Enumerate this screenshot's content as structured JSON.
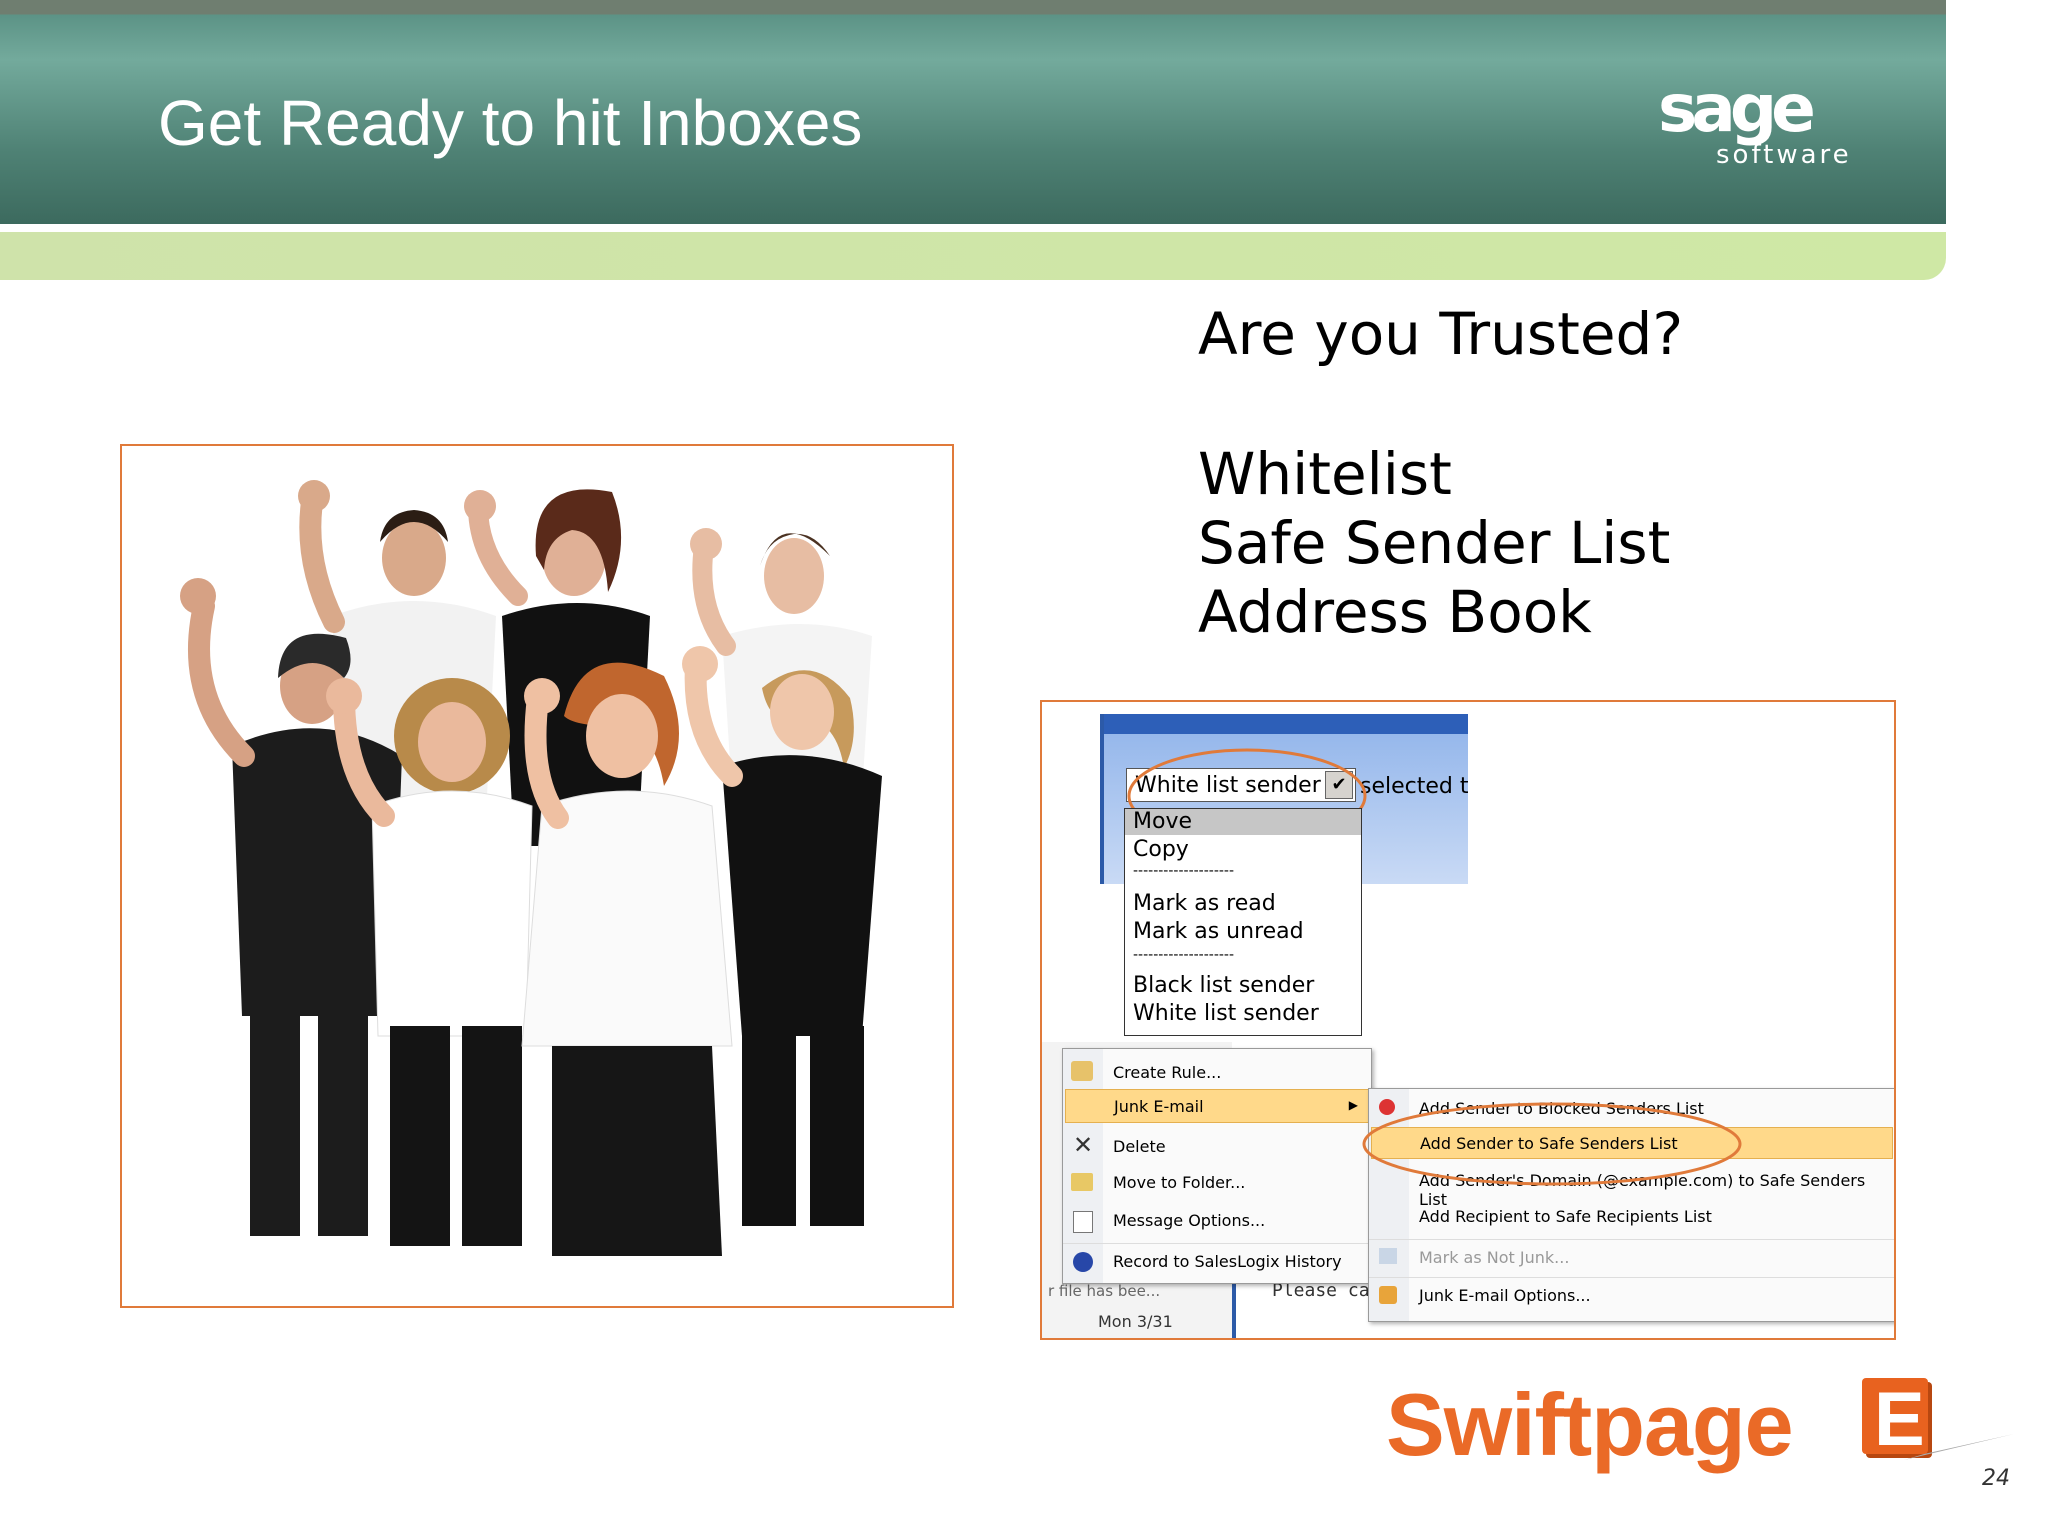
{
  "header": {
    "title": "Get Ready to hit Inboxes"
  },
  "brand": {
    "sage_main": "sage",
    "sage_sub": "software"
  },
  "content": {
    "heading": "Are you Trusted?",
    "items": [
      "Whitelist",
      "Safe Sender List",
      "Address Book"
    ]
  },
  "screenshot": {
    "dropdown_value": "White list sender",
    "dropdown_trailing": "selected t",
    "dropdown_options": [
      "Move",
      "Copy",
      "--------------------",
      "Mark as read",
      "Mark as unread",
      "--------------------",
      "Black list sender",
      "White list sender"
    ],
    "context_menu": [
      "Create Rule...",
      "Junk E-mail",
      "Delete",
      "Move to Folder...",
      "Message Options...",
      "Record to SalesLogix History"
    ],
    "junk_submenu": [
      "Add Sender to Blocked Senders List",
      "Add Sender to Safe Senders List",
      "Add Sender's Domain (@example.com) to Safe Senders List",
      "Add Recipient to Safe Recipients List",
      "Mark as Not Junk...",
      "Junk E-mail Options..."
    ],
    "bg_text_please": "Please ca",
    "bg_text_file": "r file has bee...",
    "bg_text_date": "Mon 3/31"
  },
  "footer": {
    "brand_word": "Swiftpage",
    "brand_letter": "E",
    "page_number": "24"
  },
  "colors": {
    "accent_orange": "#e07a3a",
    "header_green": "#4f8275",
    "band_green": "#cfe3aa",
    "menu_highlight": "#ffd98a"
  }
}
